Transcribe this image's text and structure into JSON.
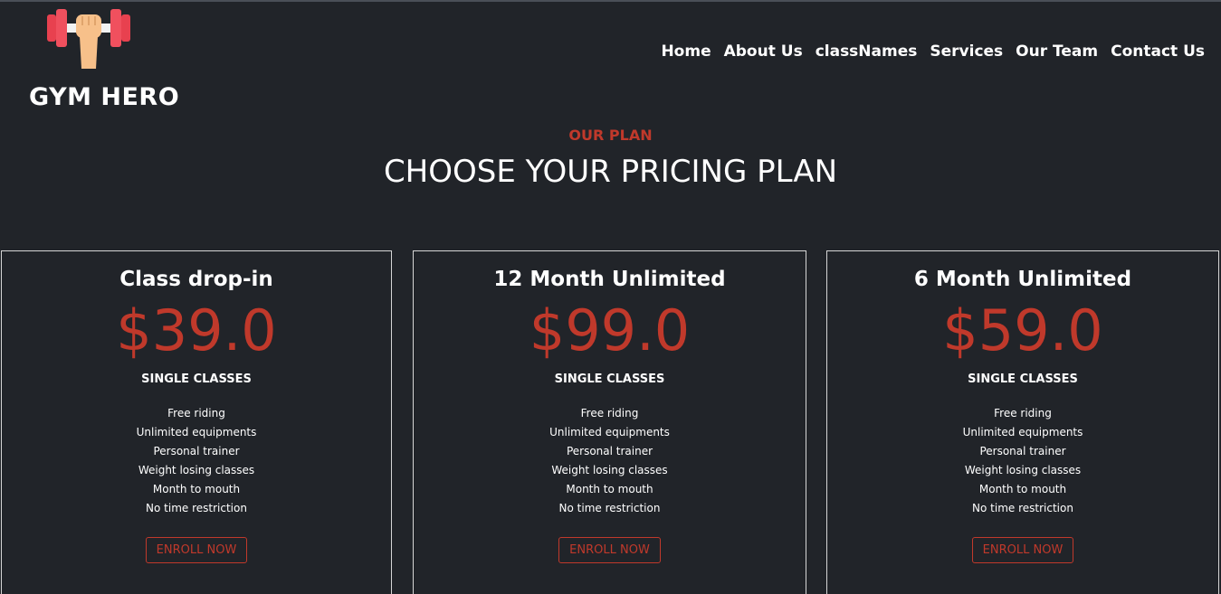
{
  "brand": {
    "name": "GYM HERO",
    "logo_icon": "dumbbell-fist-icon"
  },
  "nav": {
    "items": [
      "Home",
      "About Us",
      "classNames",
      "Services",
      "Our Team",
      "Contact Us"
    ]
  },
  "section": {
    "eyebrow": "OUR PLAN",
    "title": "CHOOSE YOUR PRICING PLAN"
  },
  "plans": [
    {
      "title": "Class drop-in",
      "price": "$39.0",
      "subtitle": "SINGLE CLASSES",
      "features": [
        "Free riding",
        "Unlimited equipments",
        "Personal trainer",
        "Weight losing classes",
        "Month to mouth",
        "No time restriction"
      ],
      "cta": "ENROLL NOW"
    },
    {
      "title": "12 Month Unlimited",
      "price": "$99.0",
      "subtitle": "SINGLE CLASSES",
      "features": [
        "Free riding",
        "Unlimited equipments",
        "Personal trainer",
        "Weight losing classes",
        "Month to mouth",
        "No time restriction"
      ],
      "cta": "ENROLL NOW"
    },
    {
      "title": "6 Month Unlimited",
      "price": "$59.0",
      "subtitle": "SINGLE CLASSES",
      "features": [
        "Free riding",
        "Unlimited equipments",
        "Personal trainer",
        "Weight losing classes",
        "Month to mouth",
        "No time restriction"
      ],
      "cta": "ENROLL NOW"
    }
  ],
  "colors": {
    "background": "#212429",
    "accent": "#c0392b",
    "text": "#ffffff"
  }
}
